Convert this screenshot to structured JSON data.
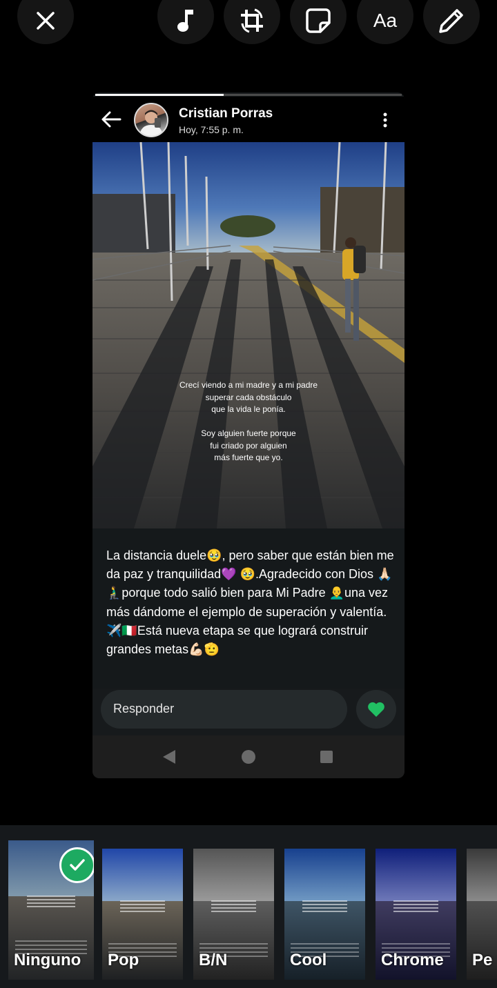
{
  "toolbar": {
    "buttons": [
      {
        "name": "close-icon"
      },
      {
        "name": "music-icon"
      },
      {
        "name": "crop-rotate-icon"
      },
      {
        "name": "sticker-icon"
      },
      {
        "name": "text-tool",
        "label": "Aa"
      },
      {
        "name": "pencil-icon"
      }
    ]
  },
  "status": {
    "author": "Cristian Porras",
    "timestamp": "Hoy, 7:55 p. m.",
    "progress": 0.42
  },
  "photo_text": {
    "lines_1": [
      "Crecí viendo a mi madre y a mi padre",
      "superar cada obstáculo",
      "que la vida le ponía."
    ],
    "lines_2": [
      "Soy alguien fuerte porque",
      "fui criado por alguien",
      "más fuerte que yo."
    ]
  },
  "caption": "La distancia duele🥹, pero saber que están bien me da paz y tranquilidad💜 🥹.Agradecido con Dios 🙏🏻🧎‍♂️porque todo salió bien  para Mi Padre 👨‍🦲una vez más dándome el ejemplo de superación y valentía. ✈️🇮🇹Está nueva etapa se que logrará construir grandes metas💪🏻🫡",
  "reply": {
    "placeholder": "Responder"
  },
  "colors": {
    "like_heart": "#21c063",
    "selected_check": "#1daa61"
  },
  "filters": [
    {
      "label": "Ninguno",
      "selected": true
    },
    {
      "label": "Pop",
      "selected": false
    },
    {
      "label": "B/N",
      "selected": false
    },
    {
      "label": "Cool",
      "selected": false
    },
    {
      "label": "Chrome",
      "selected": false
    },
    {
      "label": "Pe",
      "selected": false
    }
  ]
}
